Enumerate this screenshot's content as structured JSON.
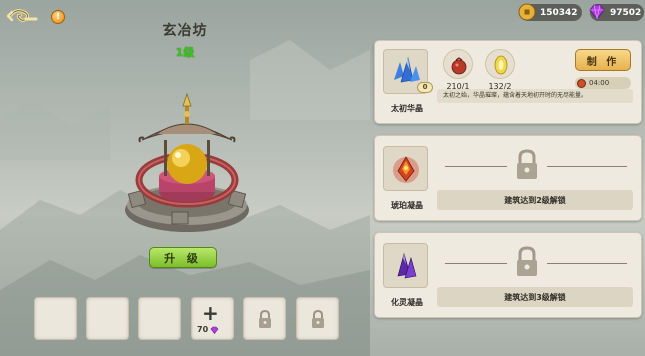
{
  "header": {
    "back_icon": "cloud-swirl-back-icon",
    "info_label": "!"
  },
  "currency": {
    "gold": {
      "value": "150342",
      "icon": "copper-coin-icon",
      "color": "#e6b23a"
    },
    "gems": {
      "value": "97502",
      "icon": "purple-gem-icon",
      "color": "#b03fe0"
    }
  },
  "building": {
    "name": "玄冶坊",
    "level": "1级",
    "upgrade_label": "升 级"
  },
  "slots": {
    "add_plus": "+",
    "add_cost": "70",
    "add_cost_icon": "purple-gem-icon"
  },
  "recipes": [
    {
      "name": "太初华晶",
      "icon": "blue-crystal-icon",
      "level_badge": "0",
      "materials": [
        {
          "icon": "red-ore-pouch-icon",
          "count": "210/1"
        },
        {
          "icon": "golden-essence-icon",
          "count": "132/2"
        }
      ],
      "craft_label": "制 作",
      "time": "04:00",
      "description": "太初之始，华晶璀璨，蕴含着天地初开时的无尽能量。"
    },
    {
      "name": "琥珀凝晶",
      "icon": "amber-crystal-icon",
      "unlock_text": "建筑达到2级解锁"
    },
    {
      "name": "化灵凝晶",
      "icon": "violet-crystal-icon",
      "unlock_text": "建筑达到3级解锁"
    }
  ]
}
